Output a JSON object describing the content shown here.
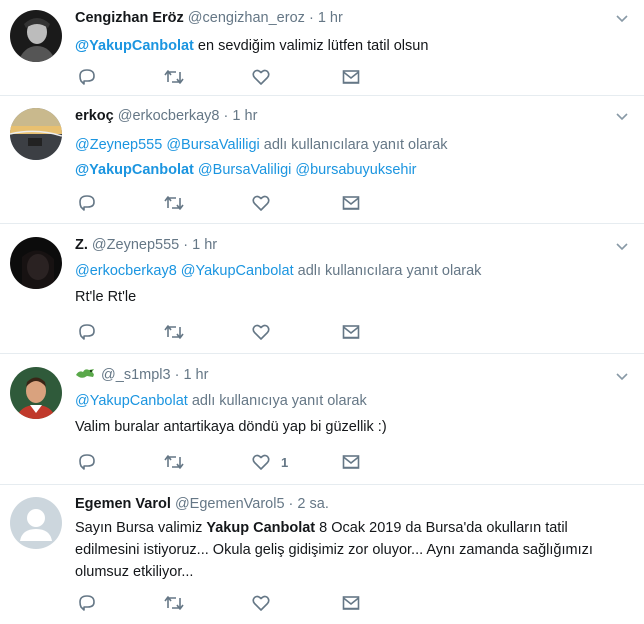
{
  "tweets": [
    {
      "name": "Cengizhan Eröz",
      "handle": "@cengizhan_eroz",
      "time": "1 hr",
      "text_mention": "@YakupCanbolat",
      "text": " en sevdiğim valimiz lütfen tatil olsun"
    },
    {
      "name": "erkoç",
      "handle": "@erkocberkay8",
      "time": "1 hr",
      "reply_m1": "@Zeynep555",
      "reply_m2": "@BursaValiligi",
      "reply_suffix": " adlı kullanıcılara yanıt olarak",
      "t_m1": "@YakupCanbolat",
      "t_m2": "@BursaValiligi",
      "t_m3": "@bursabuyuksehir"
    },
    {
      "name": "Z.",
      "handle": "@Zeynep555",
      "time": "1 hr",
      "reply_m1": "@erkocberkay8",
      "reply_m2": "@YakupCanbolat",
      "reply_suffix": " adlı kullanıcılara yanıt olarak",
      "text": "Rt'le Rt'le"
    },
    {
      "name": "",
      "handle": "@_s1mpl3",
      "time": "1 hr",
      "reply_m1": "@YakupCanbolat",
      "reply_suffix": " adlı kullanıcıya yanıt olarak",
      "text": "Valim buralar antartikaya döndü yap bi güzellik :)",
      "like_count": "1"
    },
    {
      "name": "Egemen Varol",
      "handle": "@EgemenVarol5",
      "time": "2 sa.",
      "text_a": "Sayın Bursa valimiz ",
      "text_bold": "Yakup Canbolat",
      "text_b": " 8 Ocak 2019 da Bursa'da okulların tatil edilmesini istiyoruz... Okula geliş gidişimiz zor oluyor... Aynı zamanda sağlığımızı olumsuz etkiliyor..."
    }
  ],
  "icons": {
    "reply": "reply-icon",
    "retweet": "retweet-icon",
    "like": "heart-icon",
    "dm": "envelope-icon",
    "more": "chevron-down-icon"
  },
  "colors": {
    "link": "#1b95e0",
    "muted": "#657786",
    "border": "#e6ecf0"
  }
}
